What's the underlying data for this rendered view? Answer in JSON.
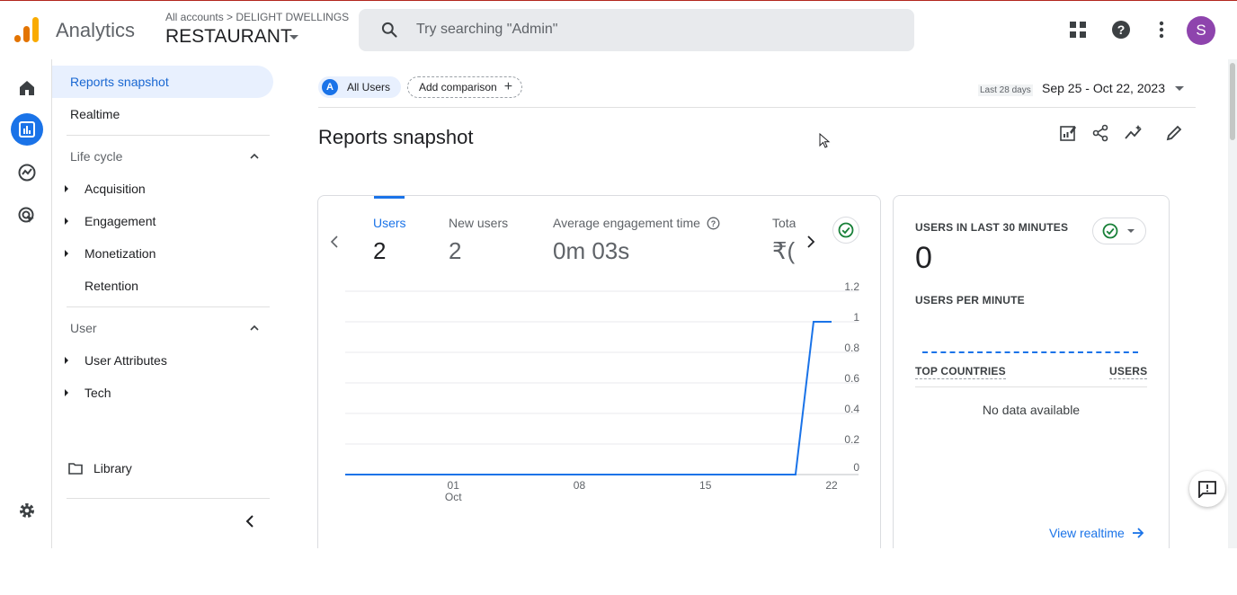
{
  "app": {
    "brand": "Analytics",
    "breadcrumb": "All accounts > DELIGHT DWELLINGS",
    "property": "RESTAURANT",
    "avatar_letter": "S"
  },
  "search": {
    "placeholder": "Try searching \"Admin\""
  },
  "nav": {
    "active": "Reports snapshot",
    "realtime": "Realtime",
    "lifecycle": "Life cycle",
    "acquisition": "Acquisition",
    "engagement": "Engagement",
    "monetization": "Monetization",
    "retention": "Retention",
    "user": "User",
    "user_attributes": "User Attributes",
    "tech": "Tech",
    "library": "Library"
  },
  "header": {
    "all_users_badge": "A",
    "all_users": "All Users",
    "add_comparison": "Add comparison",
    "date_label": "Last 28 days",
    "date_range": "Sep 25 - Oct 22, 2023",
    "title": "Reports snapshot"
  },
  "metrics": [
    {
      "label": "Users",
      "value": "2"
    },
    {
      "label": "New users",
      "value": "2"
    },
    {
      "label": "Average engagement time",
      "value": "0m 03s"
    },
    {
      "label": "Tota",
      "value": "₹("
    }
  ],
  "chart_data": {
    "type": "line",
    "x": [
      "Sep 25",
      "Sep 26",
      "Sep 27",
      "Sep 28",
      "Sep 29",
      "Sep 30",
      "Oct 01",
      "Oct 02",
      "Oct 03",
      "Oct 04",
      "Oct 05",
      "Oct 06",
      "Oct 07",
      "Oct 08",
      "Oct 09",
      "Oct 10",
      "Oct 11",
      "Oct 12",
      "Oct 13",
      "Oct 14",
      "Oct 15",
      "Oct 16",
      "Oct 17",
      "Oct 18",
      "Oct 19",
      "Oct 20",
      "Oct 21",
      "Oct 22"
    ],
    "series": [
      {
        "values": [
          0,
          0,
          0,
          0,
          0,
          0,
          0,
          0,
          0,
          0,
          0,
          0,
          0,
          0,
          0,
          0,
          0,
          0,
          0,
          0,
          0,
          0,
          0,
          0,
          0,
          0,
          1,
          1
        ]
      }
    ],
    "x_ticks": [
      {
        "label": "01",
        "sub": "Oct",
        "index": 6
      },
      {
        "label": "08",
        "sub": "",
        "index": 13
      },
      {
        "label": "15",
        "sub": "",
        "index": 20
      },
      {
        "label": "22",
        "sub": "",
        "index": 27
      }
    ],
    "y_ticks": [
      "1.2",
      "1",
      "0.8",
      "0.6",
      "0.4",
      "0.2",
      "0"
    ],
    "ylim": [
      0,
      1.2
    ],
    "color": "#1a73e8",
    "grid": true
  },
  "realtime": {
    "users_30_label": "USERS IN LAST 30 MINUTES",
    "users_30_value": "0",
    "per_minute_label": "USERS PER MINUTE",
    "top_countries": "TOP COUNTRIES",
    "users_col": "USERS",
    "no_data": "No data available",
    "view_realtime": "View realtime"
  }
}
